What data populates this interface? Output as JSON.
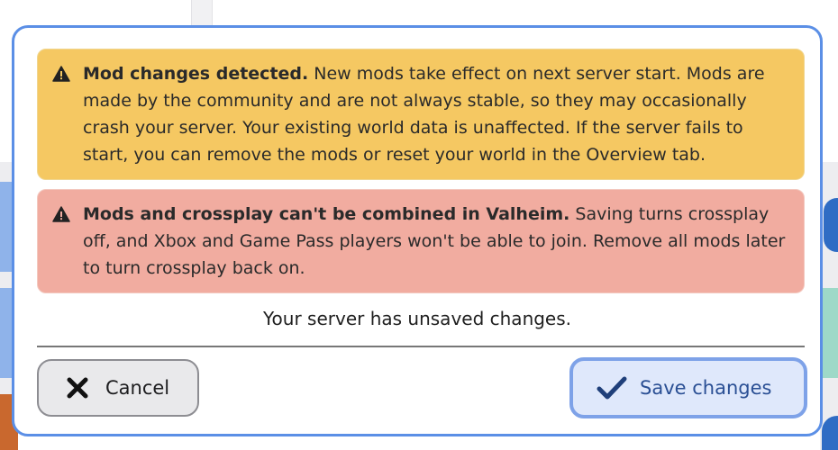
{
  "modal": {
    "warning_alert": {
      "icon": "warning-triangle-icon",
      "title": "Mod changes detected.",
      "body": " New mods take effect on next server start. Mods are made by the community and are not always stable, so they may occasionally crash your server. Your existing world data is unaffected. If the server fails to start, you can remove the mods or reset your world in the Overview tab.",
      "color": "#f5c862"
    },
    "danger_alert": {
      "icon": "warning-triangle-icon",
      "title": "Mods and crossplay can't be combined in Valheim.",
      "body": " Saving turns crossplay off, and Xbox and Game Pass players won't be able to join. Remove all mods later to turn crossplay back on.",
      "color": "#f1aca0"
    },
    "unsaved_text": "Your server has unsaved changes.",
    "cancel_button": {
      "label": "Cancel",
      "icon": "close-x-icon"
    },
    "save_button": {
      "label": "Save changes",
      "icon": "checkmark-icon",
      "accent": "#7ea2e8"
    }
  }
}
